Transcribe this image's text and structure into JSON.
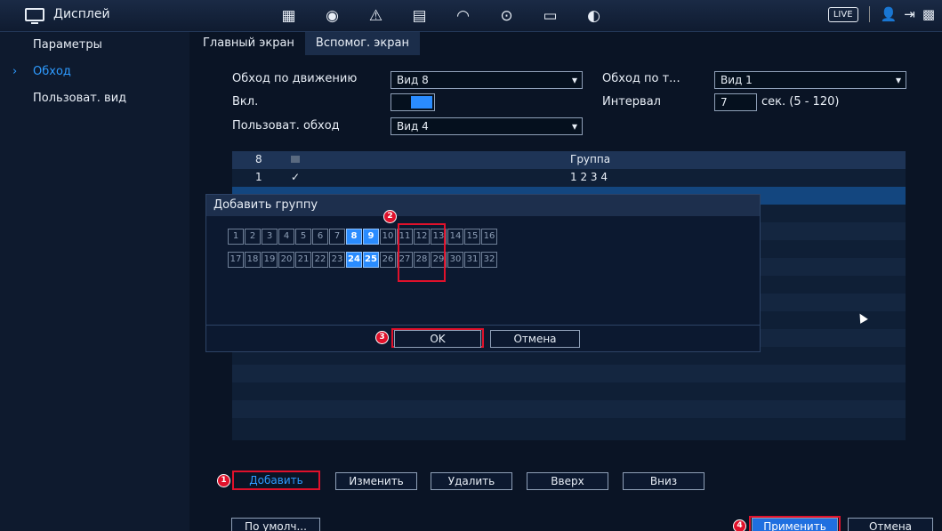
{
  "header": {
    "title": "Дисплей",
    "live_label": "LIVE",
    "icons": [
      "camera-icon",
      "network-icon",
      "alarm-icon",
      "storage-icon",
      "system-icon",
      "backup-icon",
      "display-icon",
      "audio-icon"
    ]
  },
  "sidebar": {
    "items": [
      {
        "label": "Параметры"
      },
      {
        "label": "Обход"
      },
      {
        "label": "Пользоват. вид"
      }
    ]
  },
  "tabs": [
    {
      "label": "Главный экран"
    },
    {
      "label": "Вспомог. экран"
    }
  ],
  "form": {
    "motion_tour_label": "Обход по движению",
    "motion_tour_value": "Вид 8",
    "alarm_tour_label": "Обход по т...",
    "alarm_tour_value": "Вид 1",
    "enable_label": "Вкл.",
    "interval_label": "Интервал",
    "interval_value": "7",
    "interval_unit": "сек. (5 - 120)",
    "custom_tour_label": "Пользоват. обход",
    "custom_tour_value": "Вид 4"
  },
  "table": {
    "header_num": "8",
    "header_group": "Группа",
    "rows": [
      {
        "num": "1",
        "check": "✓",
        "group": "1 2 3 4"
      }
    ]
  },
  "modal": {
    "title": "Добавить группу",
    "row1": [
      "1",
      "2",
      "3",
      "4",
      "5",
      "6",
      "7",
      "8",
      "9",
      "10",
      "11",
      "12",
      "13",
      "14",
      "15",
      "16"
    ],
    "row2": [
      "17",
      "18",
      "19",
      "20",
      "21",
      "22",
      "23",
      "24",
      "25",
      "26",
      "27",
      "28",
      "29",
      "30",
      "31",
      "32"
    ],
    "ok_label": "OK",
    "cancel_label": "Отмена"
  },
  "buttons": {
    "add": "Добавить",
    "edit": "Изменить",
    "delete": "Удалить",
    "up": "Вверх",
    "down": "Вниз",
    "default": "По умолч...",
    "apply": "Применить",
    "cancel": "Отмена"
  },
  "markers": [
    "1",
    "2",
    "3",
    "4"
  ]
}
